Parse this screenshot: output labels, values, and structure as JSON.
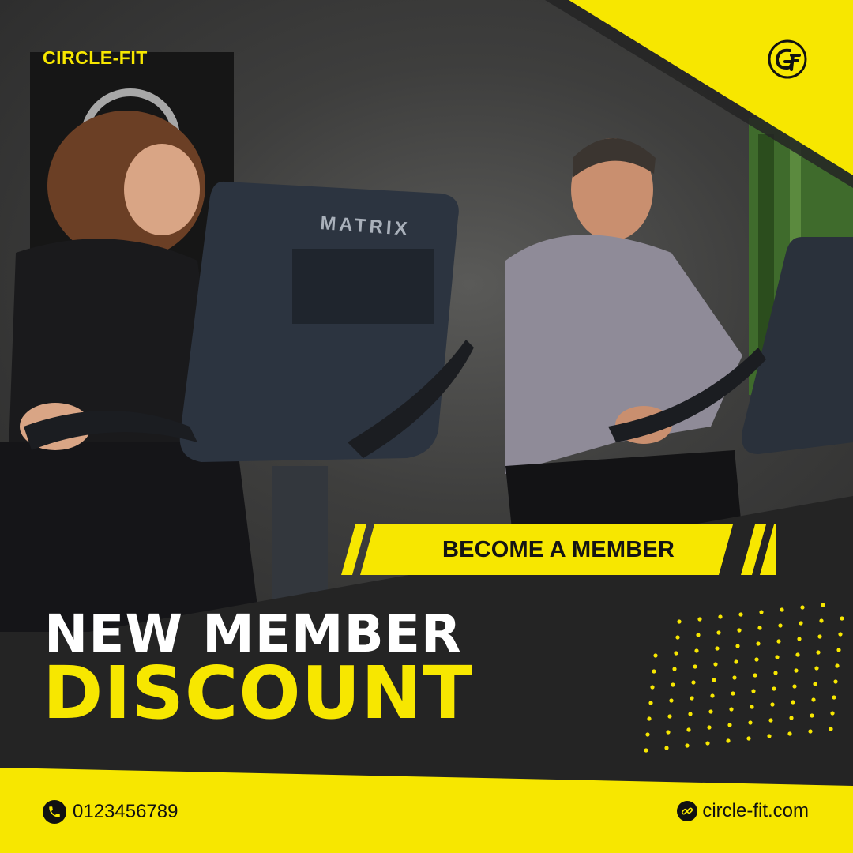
{
  "brand": {
    "name": "CIRCLE-FIT",
    "logo_icon": "circle-fit-logo-icon"
  },
  "cta": {
    "label": "BECOME A MEMBER"
  },
  "headline": {
    "line1": "NEW MEMBER",
    "line2": "DISCOUNT"
  },
  "contact": {
    "phone_icon": "phone-icon",
    "phone": "0123456789",
    "web_icon": "link-icon",
    "website": "circle-fit.com"
  },
  "photo": {
    "machine_brand": "MATRIX"
  },
  "colors": {
    "accent": "#f7e700",
    "dark": "#242424",
    "text_dark": "#111111",
    "text_light": "#ffffff"
  }
}
